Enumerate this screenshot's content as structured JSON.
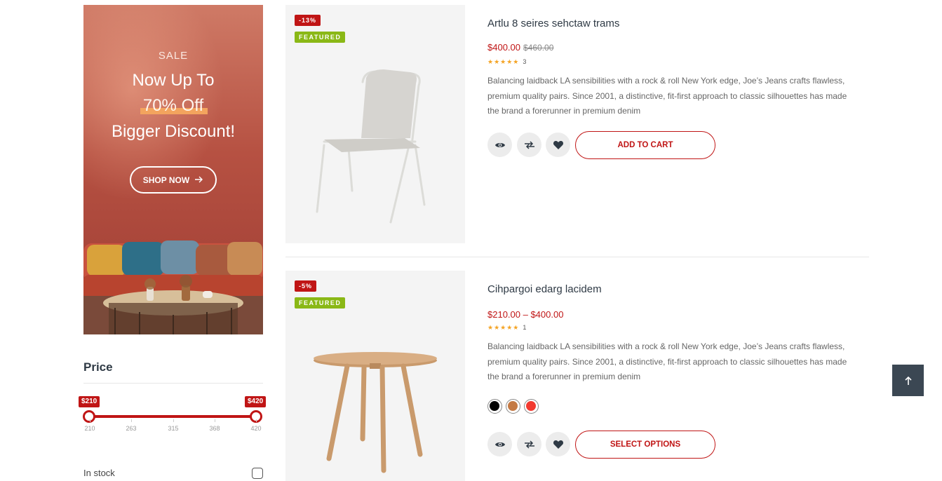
{
  "banner": {
    "sale_label": "SALE",
    "line1": "Now Up To",
    "line2": "70% Off",
    "line3": "Bigger Discount!",
    "shop_button": "SHOP NOW",
    "bg_color": "#b65142",
    "highlight_color": "#f3a45e"
  },
  "filter": {
    "price_title": "Price",
    "min_label": "$210",
    "max_label": "$420",
    "ticks": [
      "210",
      "263",
      "315",
      "368",
      "420"
    ],
    "in_stock_label": "In stock",
    "accent_color": "#c01515"
  },
  "products": [
    {
      "title": "Artlu 8 seires sehctaw trams",
      "discount": "-13%",
      "badge": "FEATURED",
      "price": "$400.00",
      "old_price": "$460.00",
      "stars": "★★★★★",
      "review_count": "3",
      "description": "Balancing laidback LA sensibilities with a rock & roll New York edge, Joe’s Jeans crafts flawless, premium quality pairs. Since 2001, a distinctive, fit-first approach to classic silhouettes has made the brand a forerunner in premium denim",
      "action": "ADD TO CART"
    },
    {
      "title": "Cihpargoi edarg lacidem",
      "discount": "-5%",
      "badge": "FEATURED",
      "price": "$210.00 – $400.00",
      "stars": "★★★★★",
      "review_count": "1",
      "description": "Balancing laidback LA sensibilities with a rock & roll New York edge, Joe’s Jeans crafts flawless, premium quality pairs. Since 2001, a distinctive, fit-first approach to classic silhouettes has made the brand a forerunner in premium denim",
      "swatches": [
        "#000000",
        "#c47a45",
        "#f23a30"
      ],
      "action": "SELECT OPTIONS"
    }
  ],
  "icons": [
    "eye-icon",
    "compare-icon",
    "heart-icon",
    "arrow-up-icon"
  ]
}
